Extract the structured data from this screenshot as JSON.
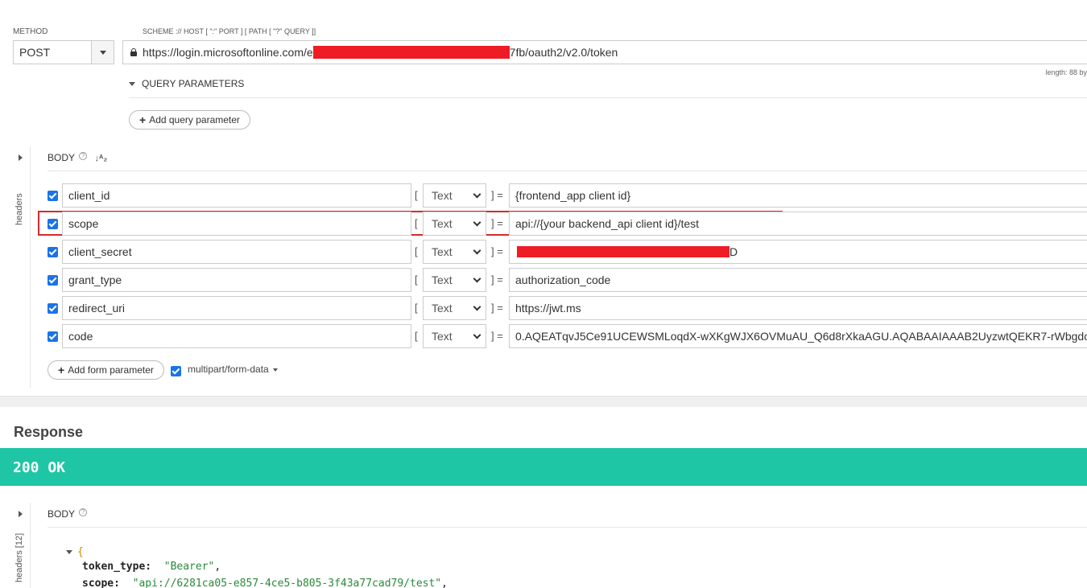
{
  "request": {
    "method_label": "METHOD",
    "method_value": "POST",
    "url_label": "SCHEME :// HOST [ \":\" PORT ] [ PATH [ \"?\" QUERY ]]",
    "url_prefix": "https://login.microsoftonline.com/e",
    "url_suffix": "7fb/oauth2/v2.0/token",
    "length_text": "length: 88 by",
    "query_params_label": "QUERY PARAMETERS",
    "add_query_param_label": "Add query parameter"
  },
  "body": {
    "side_label": "headers",
    "title": "BODY",
    "help_glyph": "?",
    "sort_glyph": "↓ᴬ₂",
    "open_bracket": "[",
    "close_bracket_eq": "] =",
    "params": [
      {
        "key": "client_id",
        "type": "Text",
        "value": "{frontend_app client id}"
      },
      {
        "key": "scope",
        "type": "Text",
        "value": "api://{your backend_api client id}/test"
      },
      {
        "key": "client_secret",
        "type": "Text",
        "value": "D"
      },
      {
        "key": "grant_type",
        "type": "Text",
        "value": "authorization_code"
      },
      {
        "key": "redirect_uri",
        "type": "Text",
        "value": "https://jwt.ms"
      },
      {
        "key": "code",
        "type": "Text",
        "value": "0.AQEATqvJ5Ce91UCEWSMLoqdX-wXKgWJX6OVMuAU_Q6d8rXkaAGU.AQABAAIAAAB2UyzwtQEKR7-rWbgdc"
      }
    ],
    "add_form_param_label": "Add form parameter",
    "encoding_label": "multipart/form-data"
  },
  "response": {
    "title": "Response",
    "status": "200 OK",
    "side_label": "headers [12]",
    "body_title": "BODY",
    "help_glyph": "?",
    "json_open": "{",
    "json_lines": [
      {
        "key": "token_type:",
        "value": "\"Bearer\"",
        "punct": ","
      },
      {
        "key": "scope:",
        "value": "\"api://6281ca05-e857-4ce5-b805-3f43a77cad79/test\"",
        "punct": ","
      }
    ]
  },
  "colors": {
    "status_ok": "#1ec6a5",
    "highlight_border": "#d22b2b",
    "checkbox": "#1a73e8",
    "redaction": "#ee1c25"
  }
}
